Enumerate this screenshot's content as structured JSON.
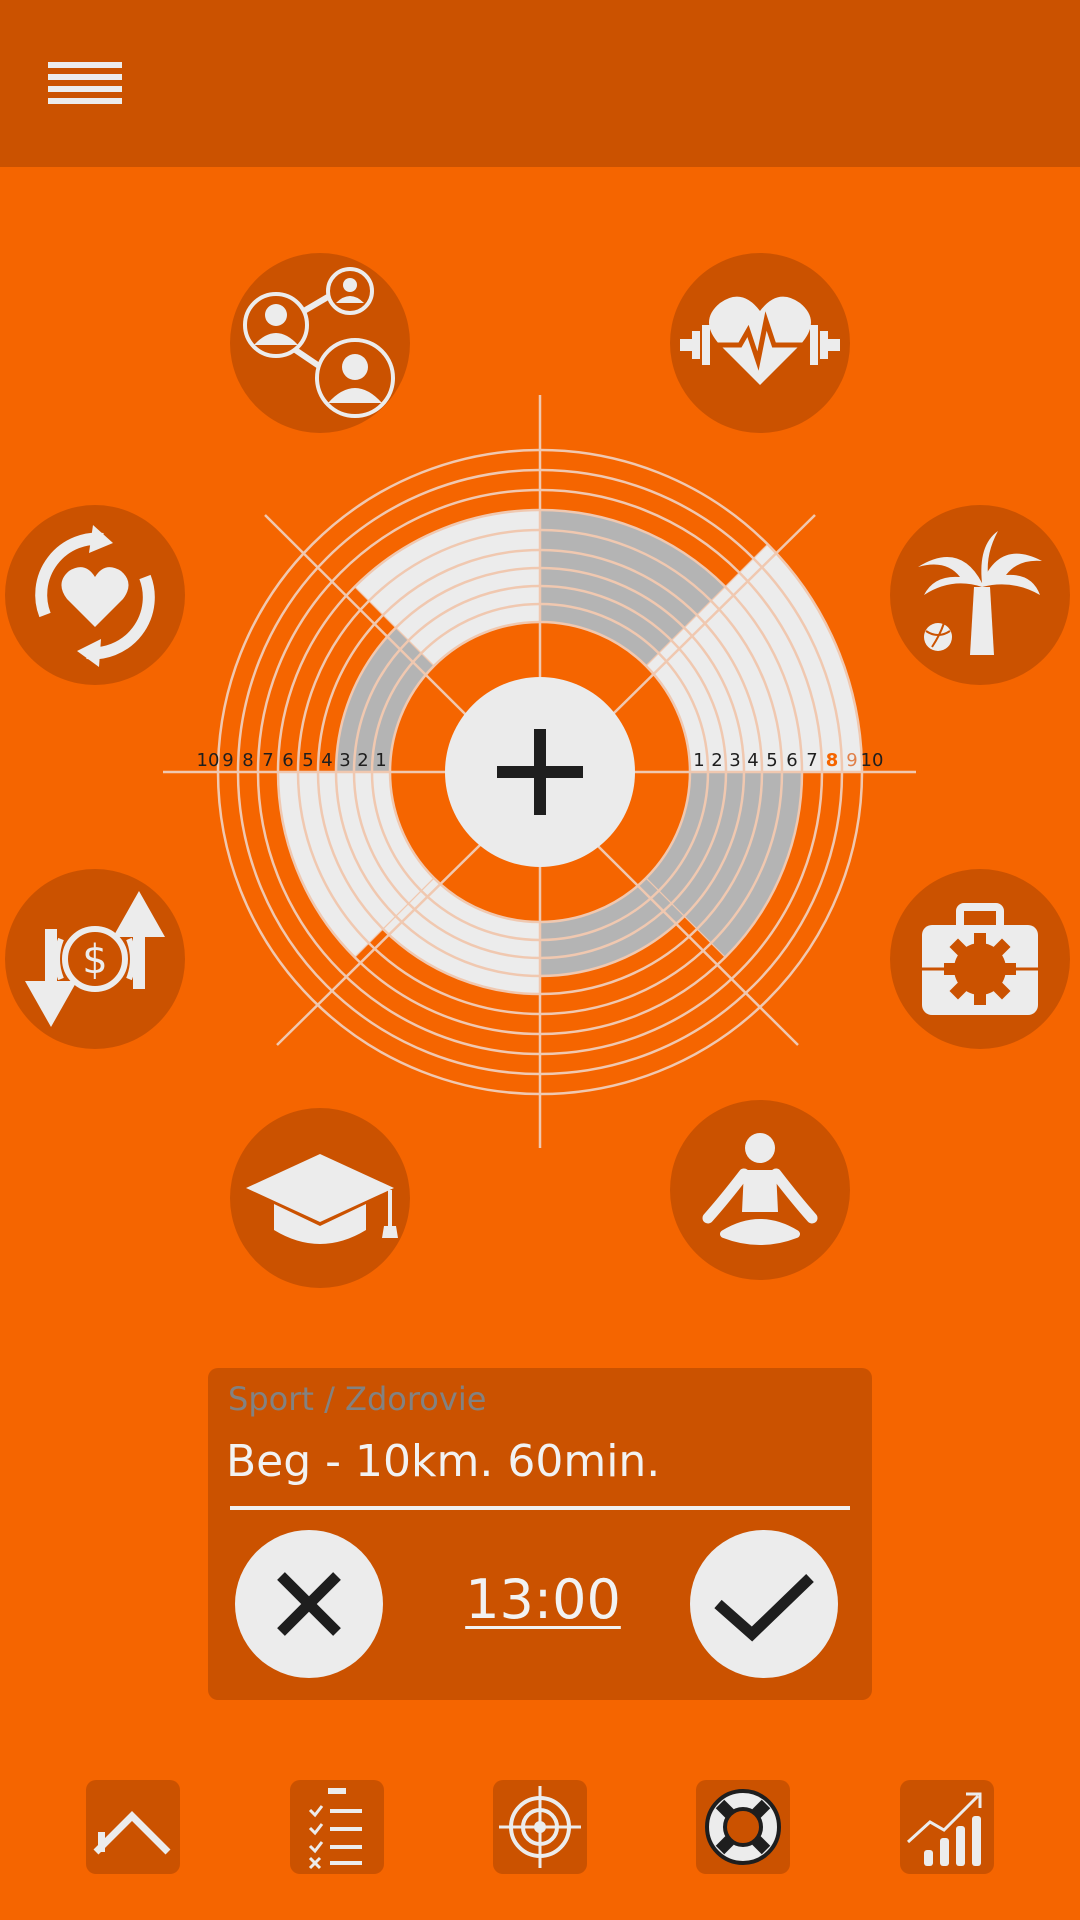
{
  "app": {
    "colors": {
      "background": "#f56500",
      "dark": "#cb5200",
      "light": "#ececec",
      "gray": "#b4b4b4",
      "highlight": "#f56500"
    }
  },
  "header": {
    "menu_icon": "hamburger-menu-icon"
  },
  "categories": [
    {
      "id": "social",
      "icon": "social-network-icon"
    },
    {
      "id": "health",
      "icon": "heart-dumbbell-icon"
    },
    {
      "id": "relationships",
      "icon": "heart-cycle-icon"
    },
    {
      "id": "leisure",
      "icon": "palm-tree-icon"
    },
    {
      "id": "finance",
      "icon": "money-flow-icon"
    },
    {
      "id": "career",
      "icon": "briefcase-gear-icon"
    },
    {
      "id": "education",
      "icon": "graduation-cap-icon"
    },
    {
      "id": "spirituality",
      "icon": "meditation-icon"
    }
  ],
  "wheel": {
    "scale_left": [
      "10",
      "9",
      "8",
      "7",
      "6",
      "5",
      "4",
      "3",
      "2",
      "1"
    ],
    "scale_right": [
      "1",
      "2",
      "3",
      "4",
      "5",
      "6",
      "7",
      "8",
      "9",
      "10"
    ],
    "highlighted_value": "8",
    "center_icon": "plus-icon"
  },
  "goal_panel": {
    "category": "Sport / Zdorovie",
    "task": "Beg - 10km. 60min.",
    "time": "13:00",
    "cancel_icon": "close-icon",
    "confirm_icon": "check-icon"
  },
  "bottom_nav": [
    {
      "id": "home",
      "icon": "home-icon"
    },
    {
      "id": "tasks",
      "icon": "checklist-icon"
    },
    {
      "id": "target",
      "icon": "target-icon"
    },
    {
      "id": "help",
      "icon": "lifebuoy-icon"
    },
    {
      "id": "stats",
      "icon": "growth-chart-icon"
    }
  ]
}
